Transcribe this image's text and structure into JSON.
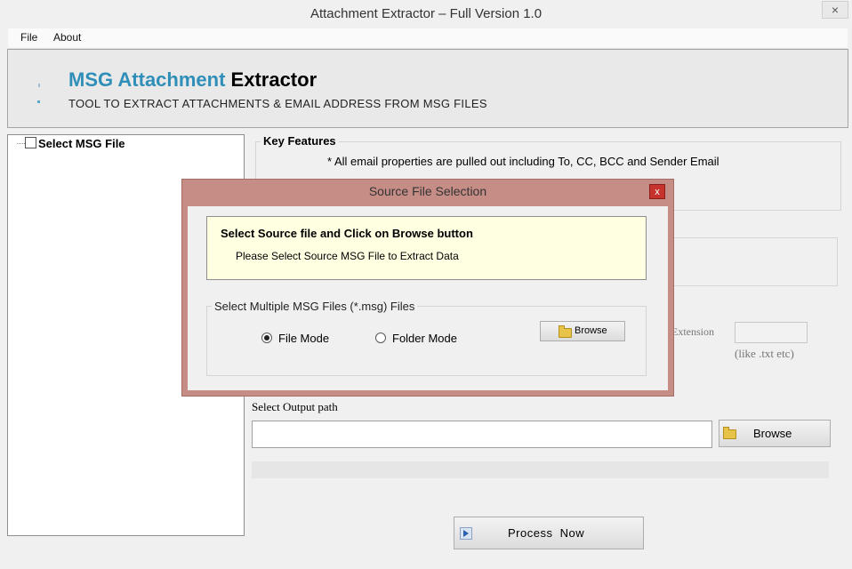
{
  "window": {
    "title": "Attachment Extractor – Full Version 1.0",
    "close_glyph": "×"
  },
  "menu": {
    "items": [
      {
        "label": "File"
      },
      {
        "label": "About"
      }
    ]
  },
  "banner": {
    "title_part1": "MSG Attachment",
    "title_part2": " Extractor",
    "subtitle": "TOOL TO EXTRACT ATTACHMENTS & EMAIL ADDRESS FROM MSG FILES",
    "accent_color": "#2f8fb8"
  },
  "tree": {
    "root_label": "Select MSG File"
  },
  "key_features": {
    "title": "Key Features",
    "line1": "* All email properties are pulled out including To, CC, BCC and Sender Email"
  },
  "extension": {
    "label": "Extension",
    "hint": "(like .txt etc)",
    "value": ""
  },
  "output": {
    "label": "Select Output path",
    "value": "",
    "browse_label": "Browse",
    "progress": 0
  },
  "process": {
    "label": "Process  Now"
  },
  "dialog": {
    "title": "Source File Selection",
    "close_glyph": "x",
    "info_title": "Select Source file and Click on Browse button",
    "info_text": "Please Select Source MSG File to Extract Data",
    "group_title": "Select Multiple MSG Files (*.msg) Files",
    "mode_file": "File Mode",
    "mode_folder": "Folder Mode",
    "selected_mode": "File Mode",
    "browse_label": "Browse",
    "frame_color": "#c68c86"
  }
}
